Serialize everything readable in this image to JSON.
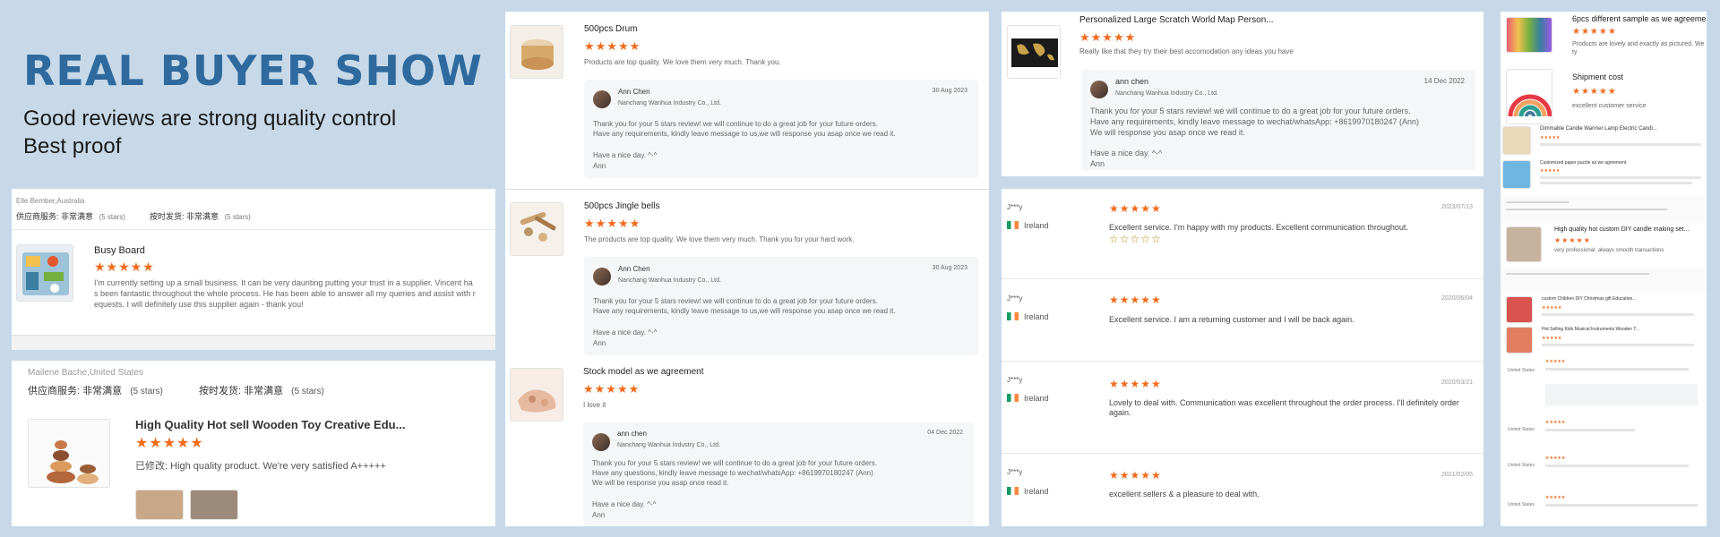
{
  "banner": {
    "title": "REAL BUYER SHOW",
    "line1": "Good reviews are strong quality control",
    "line2": "Best proof"
  },
  "review_busy": {
    "buyer": "Elle Bember,Australia",
    "supplier_service_label": "供应商服务:",
    "supplier_service_value": "非常满意",
    "supplier_service_stars": "(5 stars)",
    "delivery_label": "按时发货:",
    "delivery_value": "非常满意",
    "delivery_stars": "(5 stars)",
    "product": "Busy Board",
    "stars": "★★★★★",
    "text1": "I'm currently setting up a small business. It can be very daunting putting your trust in a supplier. Vincent ha",
    "text2": "s been fantastic throughout the whole process. He has been able to answer all my queries and assist with r",
    "text3": "equests. I will definitely use this supplier again - thank you!"
  },
  "review_toy": {
    "buyer": "Mailene Bache,United States",
    "supplier_service_label": "供应商服务:",
    "supplier_service_value": "非常满意",
    "supplier_service_stars": "(5 stars)",
    "delivery_label": "按时发货:",
    "delivery_value": "非常满意",
    "delivery_stars": "(5 stars)",
    "product": "High Quality Hot sell Wooden Toy Creative Edu...",
    "stars": "★★★★★",
    "modified_label": "已修改:",
    "text": "High quality product. We're very satisfied A+++++"
  },
  "review_drum": {
    "product": "500pcs Drum",
    "stars": "★★★★★",
    "text": "Products are top quality. We love them very much. Thank you.",
    "reply_name": "Ann Chen",
    "reply_company": "Nanchang Wanhua Industry Co., Ltd.",
    "reply_date": "30 Aug 2023",
    "reply_line1": "Thank you for your 5 stars review! we will continue to do a great job for your future orders.",
    "reply_line2": "Have any requirements, kindly leave message to us,we will response you asap once we read it.",
    "reply_line3": "Have a nice day. ^-^",
    "reply_line4": "Ann"
  },
  "review_bells": {
    "product": "500pcs Jingle bells",
    "stars": "★★★★★",
    "text": "The products are top quality. We love them very much. Thank you for your hard work.",
    "reply_name": "Ann Chen",
    "reply_company": "Nanchang Wanhua Industry Co., Ltd.",
    "reply_date": "30 Aug 2023",
    "reply_line1": "Thank you for your 5 stars review! we will continue to do a great job for your future orders.",
    "reply_line2": "Have any requirements, kindly leave message to us,we will response you asap once we read it.",
    "reply_line3": "Have a nice day. ^-^",
    "reply_line4": "Ann"
  },
  "review_stock": {
    "product": "Stock model as we agreement",
    "stars": "★★★★★",
    "text": "I love it",
    "reply_name": "ann chen",
    "reply_company": "Nanchang Wanhua Industry Co., Ltd.",
    "reply_date": "04 Dec 2022",
    "reply_line1": "Thank you for your 5 stars review! we will continue to do a great job for your future orders.",
    "reply_line2": "Have any questions, kindly leave message to wechat/whatsApp: +8619970180247 (Ann)",
    "reply_line3": "We will be response you asap once read it.",
    "reply_line4": "Have a nice day. ^-^",
    "reply_line5": "Ann"
  },
  "review_map": {
    "product": "Personalized Large Scratch World Map Person...",
    "stars": "★★★★★",
    "text": "Really like that they try their best accomodation any ideas you have",
    "reply_name": "ann chen",
    "reply_company": "Nanchang Wanhua Industry Co., Ltd.",
    "reply_date": "14 Dec 2022",
    "reply_line1": "Thank you for your 5 stars review! we will continue to do a great job for your future orders.",
    "reply_line2": "Have any requirements, kindly leave message to wechat/whatsApp: +8619970180247 (Ann)",
    "reply_line3": "We will response you asap once we read it.",
    "reply_line4": "Have a nice day. ^-^",
    "reply_line5": "Ann"
  },
  "ireland_reviews": [
    {
      "name": "J***y",
      "country": "Ireland",
      "stars": "★★★★★",
      "date": "2023/07/13",
      "text": "Excellent service. I'm happy with my products. Excellent communication throughout.",
      "extra": "☆☆☆☆☆"
    },
    {
      "name": "J***y",
      "country": "Ireland",
      "stars": "★★★★★",
      "date": "2020/06/04",
      "text": "Excellent service. I am a returning customer and I will be back again."
    },
    {
      "name": "J***y",
      "country": "Ireland",
      "stars": "★★★★★",
      "date": "2020/03/21",
      "text": "Lovely to deal with. Communication was excellent throughout the order process. I'll definitely order",
      "text2": "again."
    },
    {
      "name": "J***y",
      "country": "Ireland",
      "stars": "★★★★★",
      "date": "2021/02/05",
      "text": "excellent sellers & a pleasure to deal with."
    }
  ],
  "right_panel": {
    "item1_title": "6pcs different sample as we agreement",
    "item1_stars": "★★★★★",
    "item1_text1": "Products are lovely and exactly as pictured. We",
    "item1_text2": "ty",
    "item2_title": "Shipment cost",
    "item2_stars": "★★★★★",
    "item2_text": "excellent customer service",
    "item3_title": "Dimmable Candle Warmer Lamp Electric Candl...",
    "item4_title": "Customized paper puzzle as we agreement",
    "item5_title": "High quality hot custom DIY candle making set...",
    "item5_stars": "★★★★★",
    "item5_text1": "very professional. always smooth transactions",
    "item6_title": "custom Children DIY Christmas gift Education...",
    "item7_title": "Hot Selling Kids Musical Instruments Wooden T...",
    "country": "United States"
  }
}
